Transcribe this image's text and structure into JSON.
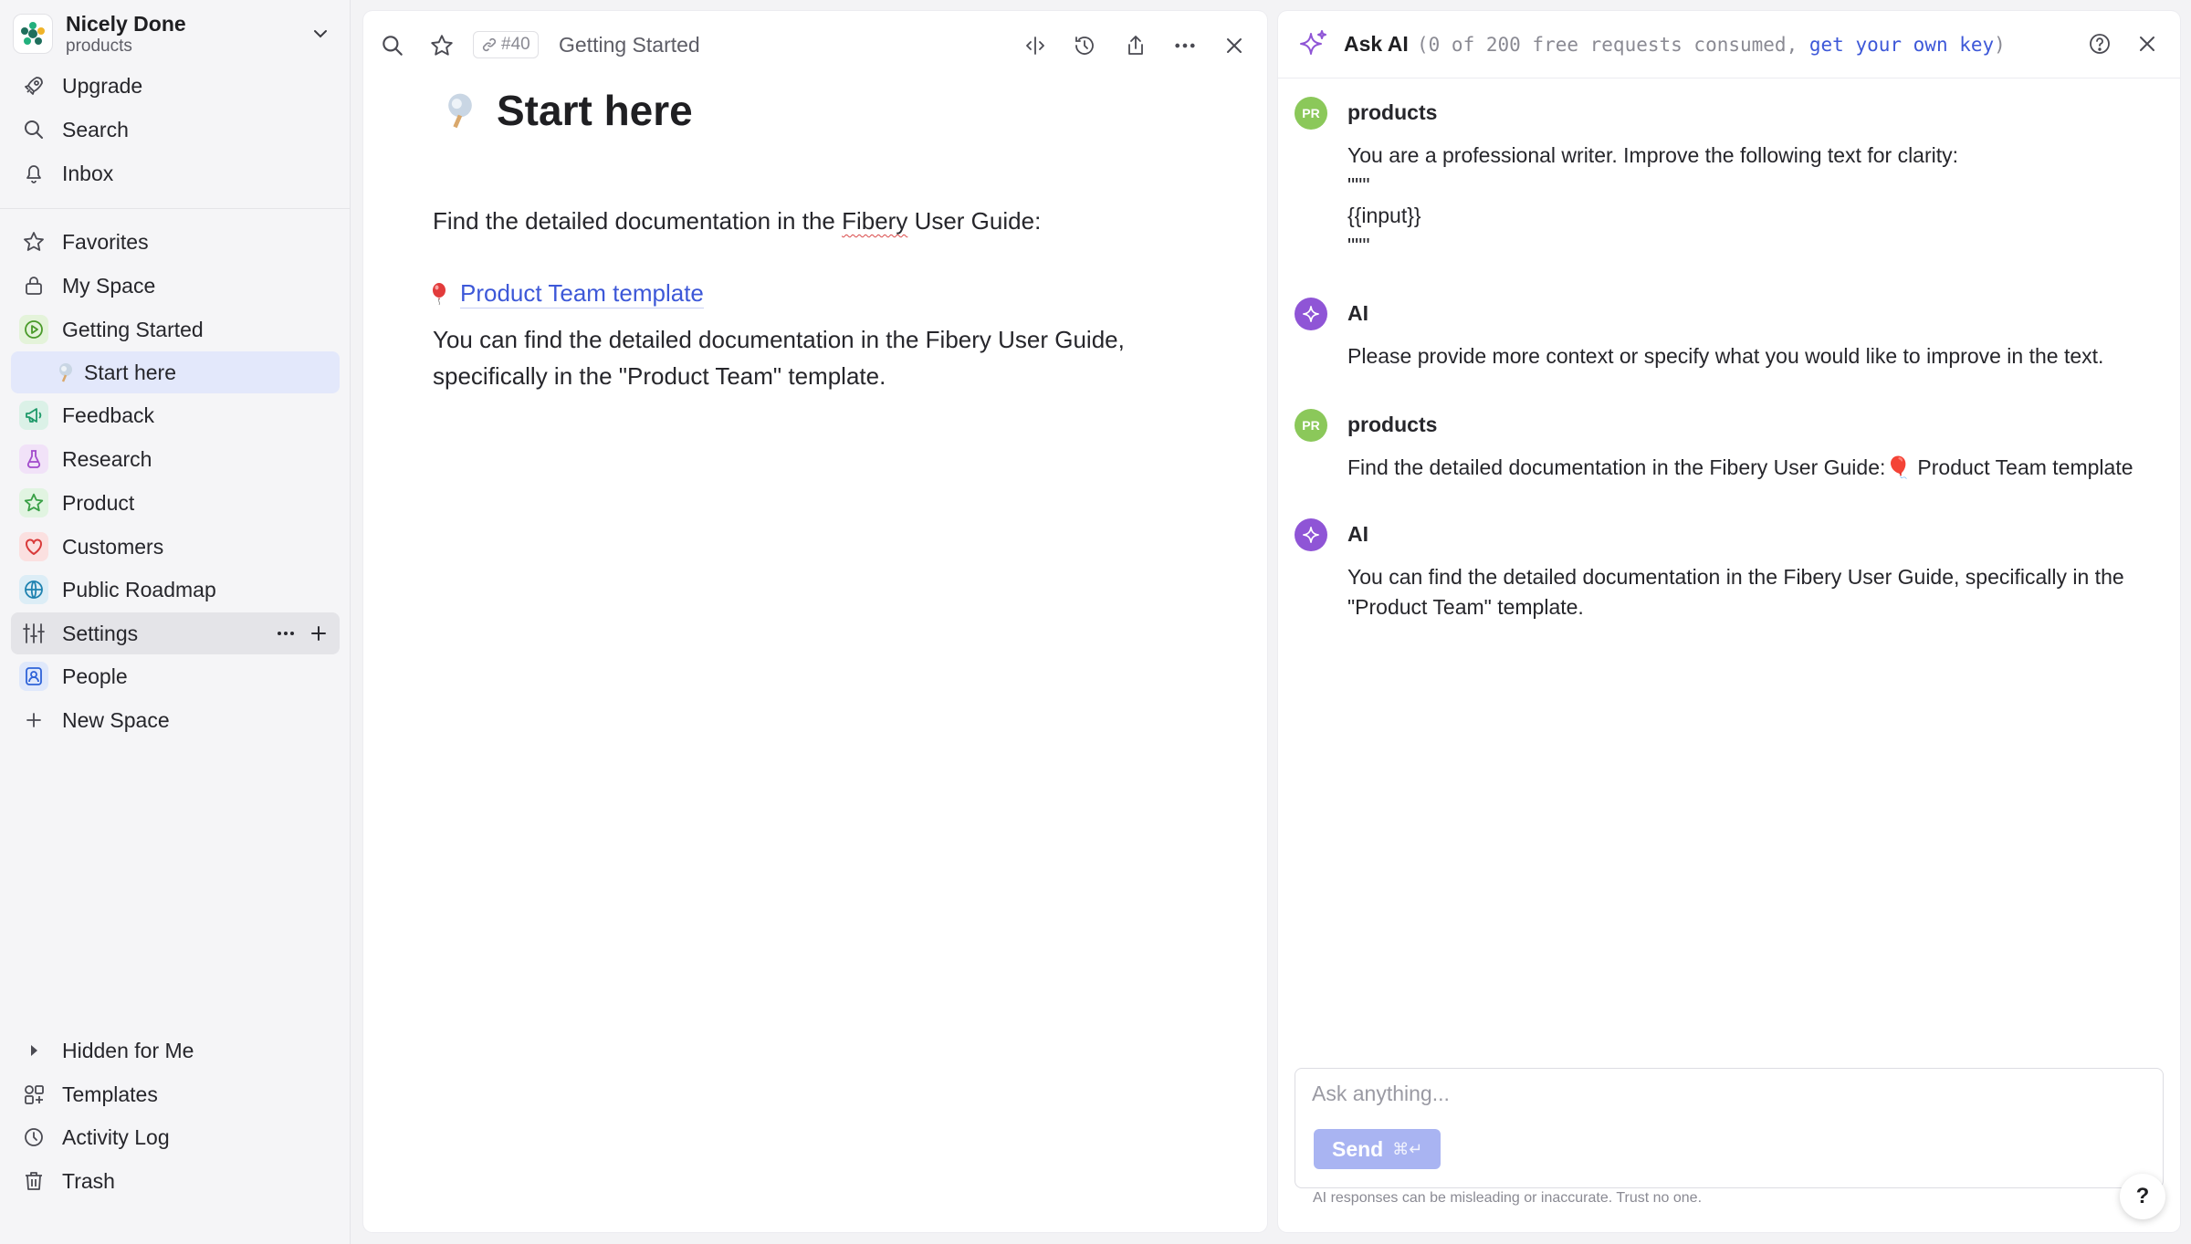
{
  "workspace": {
    "name": "Nicely Done",
    "subtitle": "products"
  },
  "sidebar": {
    "top_items": [
      {
        "label": "Upgrade",
        "icon": "rocket-icon"
      },
      {
        "label": "Search",
        "icon": "search-icon"
      },
      {
        "label": "Inbox",
        "icon": "bell-icon"
      }
    ],
    "items": [
      {
        "label": "Favorites",
        "icon": "star-icon"
      },
      {
        "label": "My Space",
        "icon": "lock-icon"
      },
      {
        "label": "Getting Started",
        "icon": "play-circle-icon"
      },
      {
        "label": "Start here",
        "icon": "doc-emoji-icon"
      },
      {
        "label": "Feedback",
        "icon": "megaphone-icon"
      },
      {
        "label": "Research",
        "icon": "flask-icon"
      },
      {
        "label": "Product",
        "icon": "star-icon"
      },
      {
        "label": "Customers",
        "icon": "heart-icon"
      },
      {
        "label": "Public Roadmap",
        "icon": "globe-icon"
      },
      {
        "label": "Settings",
        "icon": "sliders-icon"
      },
      {
        "label": "People",
        "icon": "person-badge-icon"
      },
      {
        "label": "New Space",
        "icon": "plus-icon"
      }
    ],
    "bottom_items": [
      {
        "label": "Hidden for Me",
        "icon": "caret-right-icon"
      },
      {
        "label": "Templates",
        "icon": "templates-icon"
      },
      {
        "label": "Activity Log",
        "icon": "clock-icon"
      },
      {
        "label": "Trash",
        "icon": "trash-icon"
      }
    ]
  },
  "document": {
    "entity_id": "#40",
    "breadcrumb": "Getting Started",
    "title": "Start here",
    "paragraph1_before": "Find the detailed documentation in the ",
    "paragraph1_fibery": "Fibery",
    "paragraph1_after": " User Guide:",
    "link_label": "Product Team template",
    "paragraph2": "You can find the detailed documentation in the Fibery User Guide, specifically in the \"Product Team\" template."
  },
  "ai_panel": {
    "title": "Ask AI",
    "quota_prefix": "(0 of 200 free requests consumed, ",
    "quota_link": "get your own key",
    "quota_suffix": ")",
    "messages": [
      {
        "author": "products",
        "avatar": "PR",
        "role": "user",
        "lines": [
          "You are a professional writer. Improve the following text for clarity:",
          "\"\"\"",
          "{{input}}",
          "\"\"\""
        ]
      },
      {
        "author": "AI",
        "role": "ai",
        "lines": [
          "Please provide more context or specify what you would like to improve in the text."
        ]
      },
      {
        "author": "products",
        "avatar": "PR",
        "role": "user",
        "lines": [
          "Find the detailed documentation in the Fibery User Guide:🎈 Product Team template"
        ]
      },
      {
        "author": "AI",
        "role": "ai",
        "lines": [
          "You can find the detailed documentation in the Fibery User Guide, specifically in the",
          "\"Product Team\" template."
        ]
      }
    ],
    "input_placeholder": "Ask anything...",
    "send_label": "Send",
    "send_shortcut": "⌘↵",
    "disclaimer": "AI responses can be misleading or inaccurate. Trust no one.",
    "help_label": "?"
  },
  "colors": {
    "accent": "#3d58d8",
    "selected_bg": "#e3e8fb",
    "ai_purple": "#8f55d6",
    "user_green": "#8bc85a"
  }
}
